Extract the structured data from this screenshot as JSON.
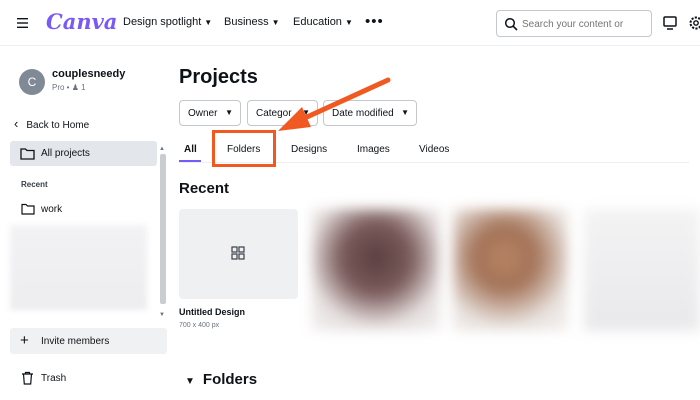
{
  "app": {
    "logo": "Canva"
  },
  "topnav": {
    "items": [
      {
        "label": "Design spotlight"
      },
      {
        "label": "Business"
      },
      {
        "label": "Education"
      }
    ],
    "more": "•••",
    "search_placeholder": "Search your content or"
  },
  "sidebar": {
    "avatar_initial": "C",
    "username": "couplesneedy",
    "plan": "Pro • ",
    "member_count": "1",
    "back_label": "Back to Home",
    "all_projects_label": "All projects",
    "recent_heading": "Recent",
    "recent_items": [
      {
        "label": "work"
      }
    ],
    "invite_label": "Invite members",
    "trash_label": "Trash"
  },
  "main": {
    "title": "Projects",
    "filters": [
      {
        "label": "Owner"
      },
      {
        "label": "Categor"
      },
      {
        "label": "Date modified"
      }
    ],
    "tabs": [
      {
        "label": "All",
        "active": true
      },
      {
        "label": "Folders",
        "active": false
      },
      {
        "label": "Designs",
        "active": false
      },
      {
        "label": "Images",
        "active": false
      },
      {
        "label": "Videos",
        "active": false
      }
    ],
    "recent_heading": "Recent",
    "designs": [
      {
        "name": "Untitled Design",
        "size": "700 x 400 px"
      }
    ],
    "folders_heading": "Folders"
  },
  "colors": {
    "brand": "#7a5af5",
    "annotation": "#f05a22",
    "selected_bg": "#e3e6ea"
  },
  "icons": [
    "menu-icon",
    "search-icon",
    "desktop-icon",
    "gear-icon",
    "folder-icon",
    "trash-icon",
    "grid-icon",
    "chevron-down-icon",
    "arrow-left-icon",
    "plus-icon"
  ]
}
